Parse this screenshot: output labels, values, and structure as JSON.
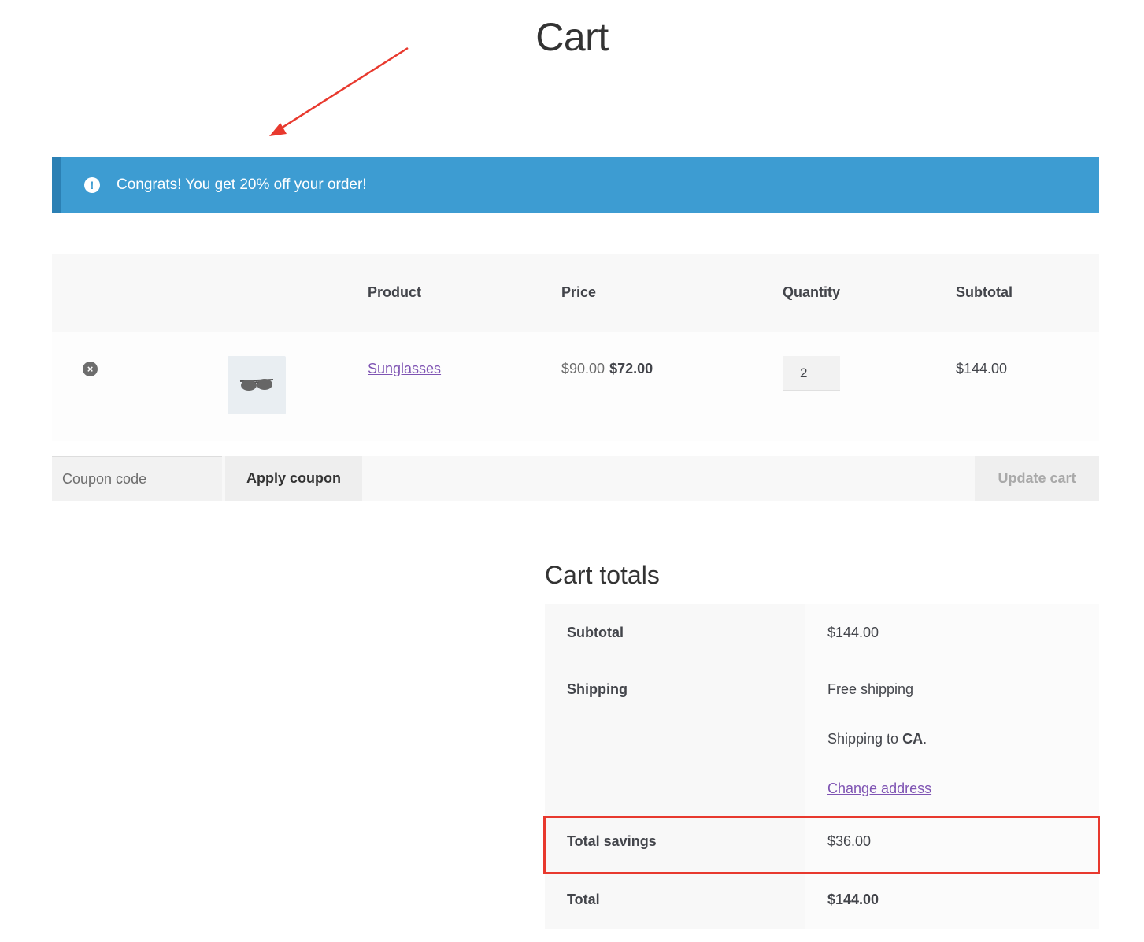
{
  "page": {
    "title": "Cart"
  },
  "notice": {
    "icon": "info-exclamation-icon",
    "text": "Congrats! You get 20% off your order!"
  },
  "table": {
    "headers": {
      "product": "Product",
      "price": "Price",
      "quantity": "Quantity",
      "subtotal": "Subtotal"
    },
    "items": [
      {
        "name": "Sunglasses",
        "regular_price": "$90.00",
        "sale_price": "$72.00",
        "quantity": "2",
        "subtotal": "$144.00",
        "thumbnail_icon": "sunglasses-icon"
      }
    ]
  },
  "actions": {
    "coupon_placeholder": "Coupon code",
    "apply_label": "Apply coupon",
    "update_label": "Update cart"
  },
  "totals": {
    "title": "Cart totals",
    "subtotal_label": "Subtotal",
    "subtotal_value": "$144.00",
    "shipping_label": "Shipping",
    "shipping_method": "Free shipping",
    "shipping_to_prefix": "Shipping to ",
    "shipping_to_place": "CA",
    "change_address": "Change address",
    "savings_label": "Total savings",
    "savings_value": "$36.00",
    "total_label": "Total",
    "total_value": "$144.00"
  },
  "colors": {
    "notice": "#3d9cd2",
    "link": "#7f54b3",
    "annotation": "#e8392e"
  }
}
